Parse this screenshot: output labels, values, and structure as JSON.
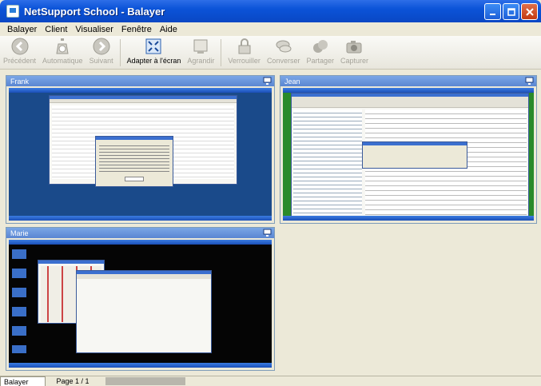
{
  "window": {
    "title": "NetSupport School - Balayer",
    "controls": [
      "minimize",
      "maximize",
      "close"
    ]
  },
  "menu": {
    "items": [
      "Balayer",
      "Client",
      "Visualiser",
      "Fenêtre",
      "Aide"
    ]
  },
  "toolbar": {
    "buttons": [
      {
        "label": "Précédent",
        "icon": "back-arrow-icon",
        "enabled": false
      },
      {
        "label": "Automatique",
        "icon": "stopwatch-icon",
        "enabled": false
      },
      {
        "label": "Suivant",
        "icon": "forward-arrow-icon",
        "enabled": false
      },
      {
        "label": "Adapter à l'écran",
        "icon": "fit-screen-icon",
        "enabled": true
      },
      {
        "label": "Agrandir",
        "icon": "enlarge-icon",
        "enabled": false
      },
      {
        "label": "Verrouiller",
        "icon": "padlock-icon",
        "enabled": false
      },
      {
        "label": "Converser",
        "icon": "chat-icon",
        "enabled": false
      },
      {
        "label": "Partager",
        "icon": "share-icon",
        "enabled": false
      },
      {
        "label": "Capturer",
        "icon": "camera-icon",
        "enabled": false
      }
    ]
  },
  "clients": [
    {
      "name": "Frank"
    },
    {
      "name": "Jean"
    },
    {
      "name": "Marie"
    }
  ],
  "status": {
    "tab": "Balayer",
    "page": "Page 1 / 1"
  },
  "colors": {
    "titlebar": "#0b53d8",
    "desktop_blue": "#1a4a8a",
    "desktop_black": "#050505",
    "thumb_header": "#6a96dc"
  }
}
